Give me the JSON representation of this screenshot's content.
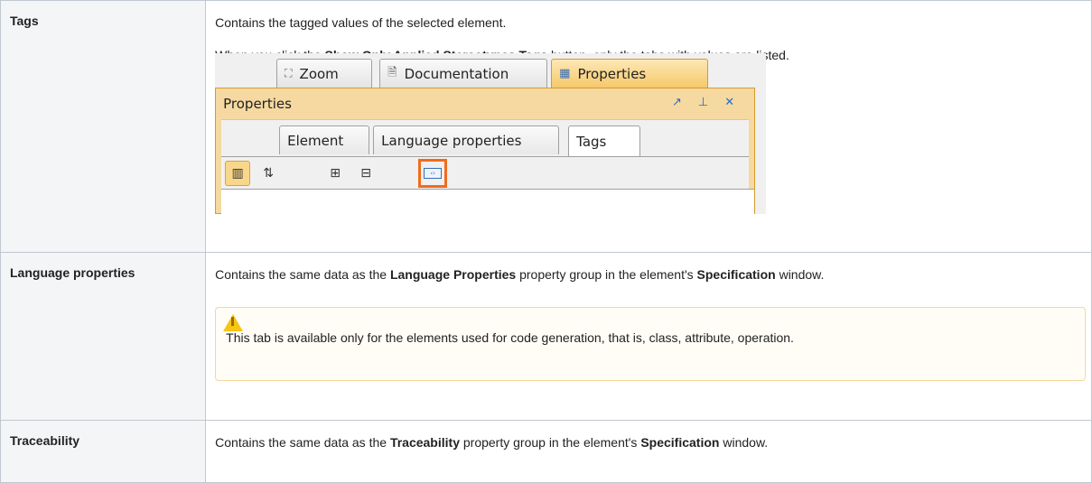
{
  "rows": [
    {
      "name": "Tags",
      "desc": "Contains the tagged values of the selected element.",
      "desc2_pre": "When you click the ",
      "desc2_bold": "Show Only Applied Stereotypes Tags",
      "desc2_post": " button, only the tabs with values are listed."
    },
    {
      "name": "Language properties",
      "desc_pre": "Contains the same data as the ",
      "desc_bold1": "Language Properties",
      "desc_mid": " property group in the element's ",
      "desc_bold2": "Specification",
      "desc_post": " window.",
      "note": "This tab is available only for the elements used for code generation, that is, class, attribute, operation."
    },
    {
      "name": "Traceability",
      "desc_pre": "Contains the same data as the ",
      "desc_bold1": "Traceability",
      "desc_mid": " property group in the element's ",
      "desc_bold2": "Specification",
      "desc_post": " window."
    }
  ],
  "screenshot": {
    "top_tabs": [
      "Zoom",
      "Documentation",
      "Properties"
    ],
    "panel_title": "Properties",
    "inner_tabs": [
      "Element",
      "Language properties",
      "Tags"
    ],
    "icons": {
      "zoom": "zoom-icon",
      "documentation": "document-icon",
      "properties": "table-icon",
      "float": "float-window-icon",
      "pin": "pin-icon",
      "close": "close-icon",
      "categorized": "categorized-view-icon",
      "sort": "sort-az-icon",
      "expand": "expand-all-icon",
      "collapse": "collapse-all-icon",
      "applied": "show-applied-stereotypes-tags-icon"
    },
    "highlight_color": "#f26b1d",
    "active_tab_color": "#f6c96a"
  },
  "colors": {
    "border": "#c1c7d0",
    "header_bg": "#f4f5f7",
    "note_border": "#f7d6a0",
    "warning": "#f5c518"
  }
}
